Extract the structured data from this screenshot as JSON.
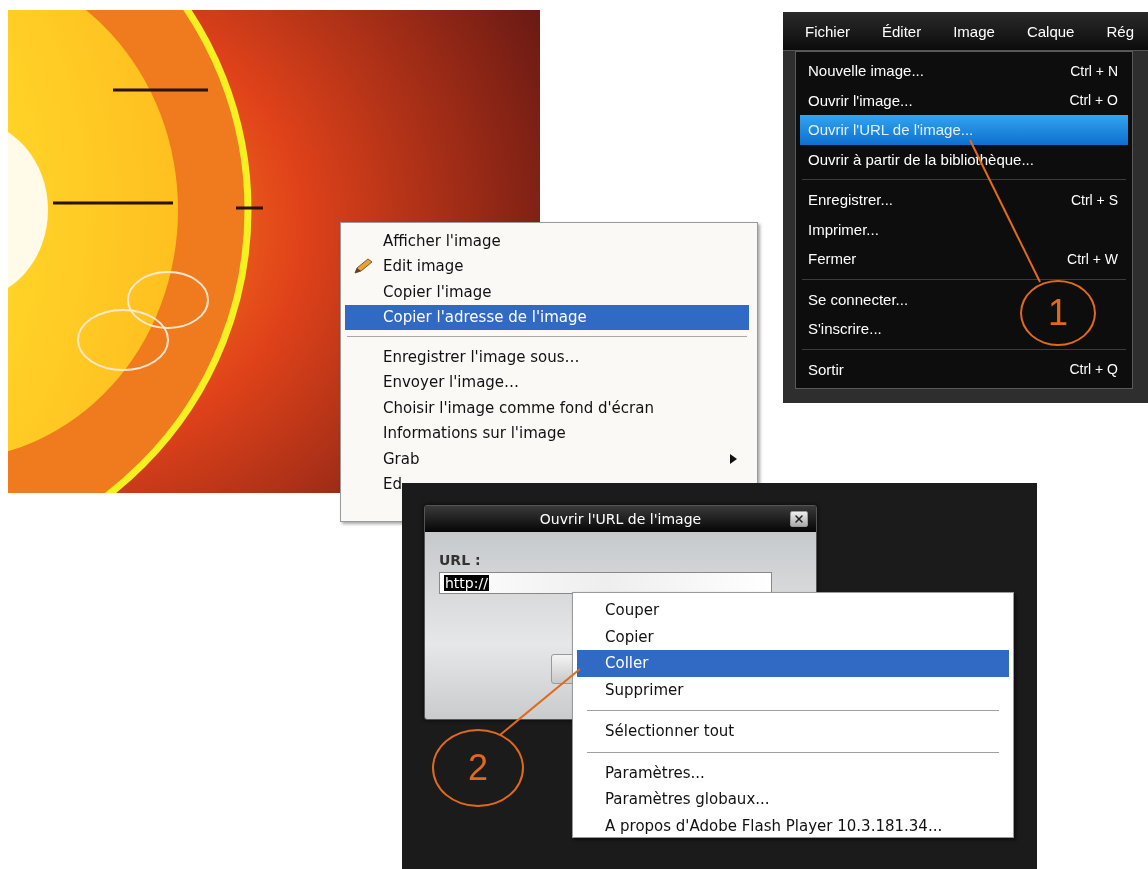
{
  "browser_menu": {
    "groups": [
      [
        {
          "label": "Afficher l'image",
          "kind": "plain",
          "selected": false
        },
        {
          "label": "Edit image",
          "kind": "with_icon",
          "selected": false
        },
        {
          "label": "Copier l'image",
          "kind": "plain",
          "selected": false
        },
        {
          "label": "Copier l'adresse de l'image",
          "kind": "plain",
          "selected": true
        }
      ],
      [
        {
          "label": "Enregistrer l'image sous…",
          "kind": "plain",
          "selected": false
        },
        {
          "label": "Envoyer l'image…",
          "kind": "plain",
          "selected": false
        },
        {
          "label": "Choisir l'image comme fond d'écran",
          "kind": "plain",
          "selected": false
        },
        {
          "label": "Informations sur l'image",
          "kind": "plain",
          "selected": false
        },
        {
          "label": "Grab",
          "kind": "submenu",
          "selected": false
        },
        {
          "label": "Ed",
          "kind": "plain",
          "selected": false
        }
      ]
    ]
  },
  "editor": {
    "menubar": [
      "Fichier",
      "Éditer",
      "Image",
      "Calque",
      "Rég"
    ],
    "menu_groups": [
      [
        {
          "label": "Nouvelle image...",
          "shortcut": "Ctrl + N",
          "selected": false
        },
        {
          "label": "Ouvrir l'image...",
          "shortcut": "Ctrl + O",
          "selected": false
        },
        {
          "label": "Ouvrir l'URL de l'image...",
          "selected": true
        },
        {
          "label": "Ouvrir à partir de la bibliothèque...",
          "selected": false
        }
      ],
      [
        {
          "label": "Enregistrer...",
          "shortcut": "Ctrl + S",
          "selected": false
        },
        {
          "label": "Imprimer...",
          "selected": false
        },
        {
          "label": "Fermer",
          "shortcut": "Ctrl + W",
          "selected": false
        }
      ],
      [
        {
          "label": "Se connecter...",
          "selected": false
        },
        {
          "label": "S'inscrire...",
          "selected": false
        }
      ],
      [
        {
          "label": "Sortir",
          "shortcut": "Ctrl + Q",
          "selected": false
        }
      ]
    ],
    "callout": "1"
  },
  "flash": {
    "dialog": {
      "title": "Ouvrir l'URL de l'image",
      "url_label": "URL :",
      "url_value": "http://"
    },
    "context_menu": [
      [
        {
          "label": "Couper",
          "selected": false
        },
        {
          "label": "Copier",
          "selected": false
        },
        {
          "label": "Coller",
          "selected": true
        },
        {
          "label": "Supprimer",
          "selected": false
        }
      ],
      [
        {
          "label": "Sélectionner tout",
          "selected": false
        }
      ],
      [
        {
          "label": "Paramètres...",
          "selected": false
        },
        {
          "label": "Paramètres globaux...",
          "selected": false
        },
        {
          "label": "A propos d'Adobe Flash Player 10.3.181.34...",
          "selected": false
        }
      ]
    ],
    "callout": "2"
  }
}
